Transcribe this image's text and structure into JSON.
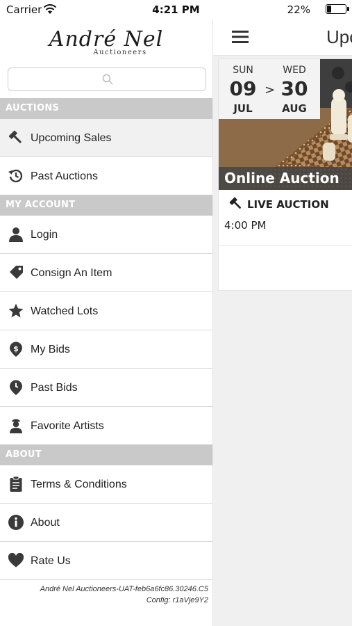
{
  "status_bar": {
    "carrier": "Carrier",
    "time": "4:21 PM",
    "battery": "22%",
    "battery_level": 0.22
  },
  "brand": {
    "name": "André Nel",
    "subtitle": "Auctioneers"
  },
  "search": {
    "placeholder": ""
  },
  "menu": {
    "sections": [
      {
        "title": "AUCTIONS",
        "items": [
          {
            "label": "Upcoming Sales",
            "icon": "gavel-icon",
            "selected": true
          },
          {
            "label": "Past Auctions",
            "icon": "history-icon",
            "selected": false
          }
        ]
      },
      {
        "title": "MY ACCOUNT",
        "items": [
          {
            "label": "Login",
            "icon": "user-icon"
          },
          {
            "label": "Consign An Item",
            "icon": "tag-icon"
          },
          {
            "label": "Watched Lots",
            "icon": "star-icon"
          },
          {
            "label": "My Bids",
            "icon": "bid-pin-icon"
          },
          {
            "label": "Past Bids",
            "icon": "clock-pin-icon"
          },
          {
            "label": "Favorite Artists",
            "icon": "artist-icon"
          }
        ]
      },
      {
        "title": "ABOUT",
        "items": [
          {
            "label": "Terms & Conditions",
            "icon": "clipboard-icon"
          },
          {
            "label": "About",
            "icon": "info-icon"
          },
          {
            "label": "Rate Us",
            "icon": "heart-icon"
          }
        ]
      }
    ],
    "version": "André Nel Auctioneers-UAT-feb6a6fc86.30246.C5",
    "config": "Config: r1aVje9Y2"
  },
  "main": {
    "nav_title": "Upcoming Sales",
    "auction": {
      "start": {
        "dow": "SUN",
        "day": "09",
        "month": "JUL"
      },
      "arrow": ">",
      "end": {
        "dow": "WED",
        "day": "30",
        "month": "AUG"
      },
      "caption": "Online Auction",
      "type": "LIVE AUCTION",
      "time": "4:00 PM"
    }
  },
  "colors": {
    "section_header_bg": "#c9c9c9",
    "selected_row_bg": "#f1f1f1",
    "icon_color": "#3a3a3a",
    "caption_bg": "#464646"
  }
}
